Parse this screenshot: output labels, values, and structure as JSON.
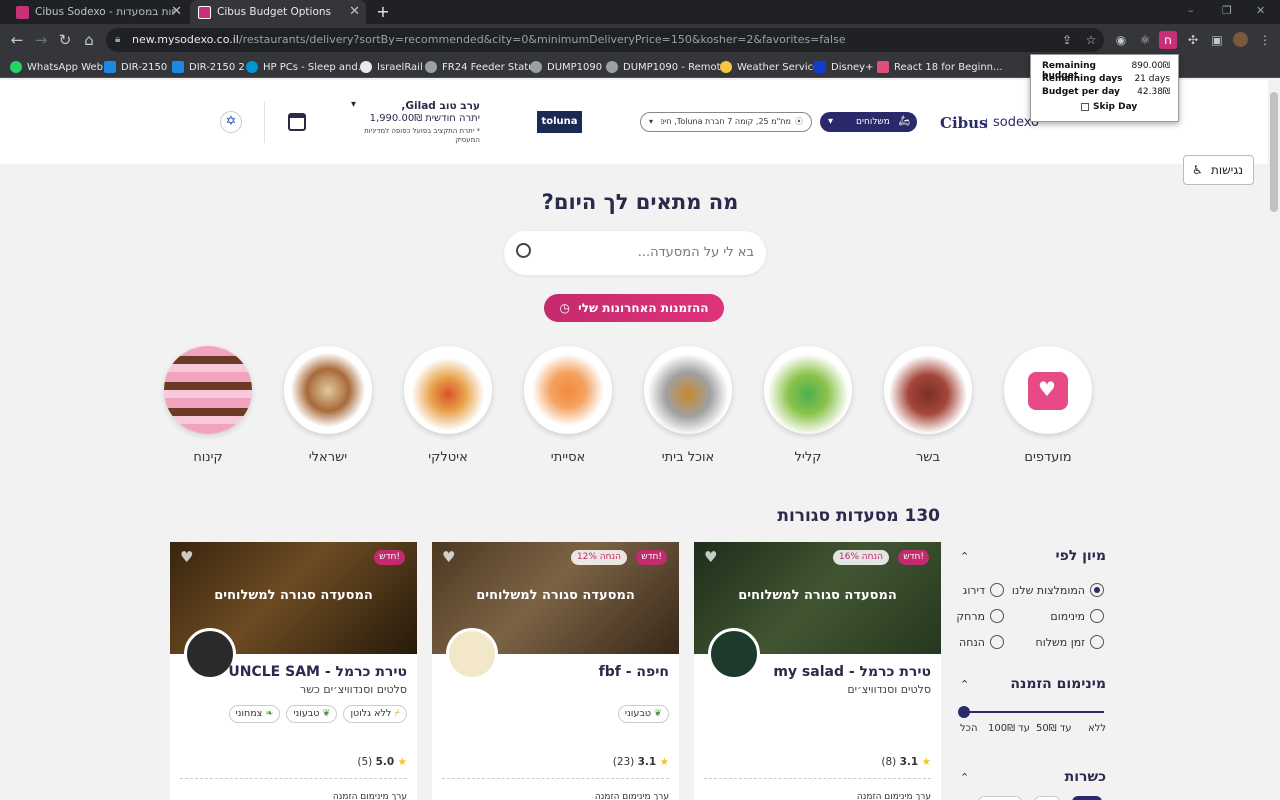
{
  "browser": {
    "tabs": [
      {
        "title": "Cibus Sodexo - הנחות במסעדות"
      },
      {
        "title": "Cibus Budget Options"
      }
    ],
    "new_tab": "+",
    "url_domain": "new.mysodexo.co.il",
    "url_path": "/restaurants/delivery?sortBy=recommended&city=0&minimumDeliveryPrice=150&kosher=2&favorites=false",
    "window_controls": [
      "–",
      "❐",
      "✕"
    ]
  },
  "bookmarks": [
    {
      "label": "WhatsApp Web",
      "color": "#25d366"
    },
    {
      "label": "DIR-2150",
      "color": "#1e88e5"
    },
    {
      "label": "DIR-2150 2",
      "color": "#1e88e5"
    },
    {
      "label": "HP PCs - Sleep and...",
      "color": "#0096d6"
    },
    {
      "label": "IsraelRail",
      "color": "#e8eaed"
    },
    {
      "label": "FR24 Feeder Status",
      "color": "#9aa0a6"
    },
    {
      "label": "DUMP1090",
      "color": "#9aa0a6"
    },
    {
      "label": "DUMP1090 - Remote",
      "color": "#9aa0a6"
    },
    {
      "label": "Weather Service",
      "color": "#f6c644"
    },
    {
      "label": "Disney+",
      "color": "#113ccf"
    },
    {
      "label": "React 18 for Beginn...",
      "color": "#e04e7a"
    }
  ],
  "budget_popup": {
    "remaining_budget_label": "Remaining budget",
    "remaining_budget_value": "890.00₪",
    "remaining_days_label": "Remaining days",
    "remaining_days_value": "21 days",
    "budget_per_day_label": "Budget per day",
    "budget_per_day_value": "42.38₪",
    "skip_day_label": "Skip Day"
  },
  "header": {
    "brand_cibus": "Cibus",
    "brand_sodexo": "sodexo",
    "delivery_mode": "משלוחים",
    "address": "מת\"מ 25, קומה 7 חברת Toluna, חיפ...",
    "company_logo": "toluna",
    "greeting": "ערב טוב Gilad,",
    "balance": "יתרה חודשית 1,990.00₪",
    "balance_note": "* יתרת התקציב בפועל כפופה למדיניות המעסיק",
    "accessibility": "נגישות"
  },
  "hero": {
    "title": "מה מתאים לך היום?",
    "search_placeholder": "בא לי על המסעדה...",
    "recent_orders": "ההזמנות האחרונות שלי"
  },
  "categories": [
    {
      "label": "מועדפים"
    },
    {
      "label": "בשר"
    },
    {
      "label": "קליל"
    },
    {
      "label": "אוכל ביתי"
    },
    {
      "label": "אסייתי"
    },
    {
      "label": "איטלקי"
    },
    {
      "label": "ישראלי"
    },
    {
      "label": "קינוח"
    }
  ],
  "results_count": "130 מסעדות סגורות",
  "filters": {
    "sort_title": "מיון לפי",
    "sort_options": [
      "המומלצות שלנו",
      "דירוג",
      "מינימום",
      "מרחק",
      "זמן משלוח",
      "הנחה"
    ],
    "sort_selected": "המומלצות שלנו",
    "min_order_title": "מינימום הזמנה",
    "min_order_ticks": [
      "ללא",
      "עד 50₪",
      "עד 100₪",
      "הכל"
    ],
    "min_order_level": 0,
    "kosher_title": "כשרות"
  },
  "restaurants": [
    {
      "name": "my salad - טירת כרמל",
      "category": "סלטים וסנדוויצ׳ים",
      "status": "המסעדה סגורה למשלוחים",
      "new_badge": "חדש!",
      "discount": "16% הנחה",
      "tags": [],
      "rating": "3.1",
      "reviews": "(8)",
      "min_order": "ערך מינימום הזמנה",
      "colors": {
        "img": "#4f6a3e",
        "logo": "#1d3a2a"
      }
    },
    {
      "name": "fbf - חיפה",
      "category": "",
      "status": "המסעדה סגורה למשלוחים",
      "new_badge": "חדש!",
      "discount": "12% הנחה",
      "tags": [
        "טבעוני"
      ],
      "rating": "3.1",
      "reviews": "(23)",
      "min_order": "ערך מינימום הזמנה",
      "colors": {
        "img": "#8a6a45",
        "logo": "#f2e7c8"
      }
    },
    {
      "name": "UNCLE SAM - טירת כרמל",
      "category": "סלטים וסנדוויצ׳ים כשר",
      "status": "המסעדה סגורה למשלוחים",
      "new_badge": "חדש!",
      "discount": "",
      "tags": [
        "ללא גלוטן",
        "טבעוני",
        "צמחוני"
      ],
      "rating": "5.0",
      "reviews": "(5)",
      "min_order": "ערך מינימום הזמנה",
      "colors": {
        "img": "#6e4a22",
        "logo": "#2a2a2a"
      }
    }
  ],
  "colors": {
    "brand_navy": "#2a2a6a",
    "brand_pink": "#e0337d",
    "chrome_dark": "#202124"
  }
}
